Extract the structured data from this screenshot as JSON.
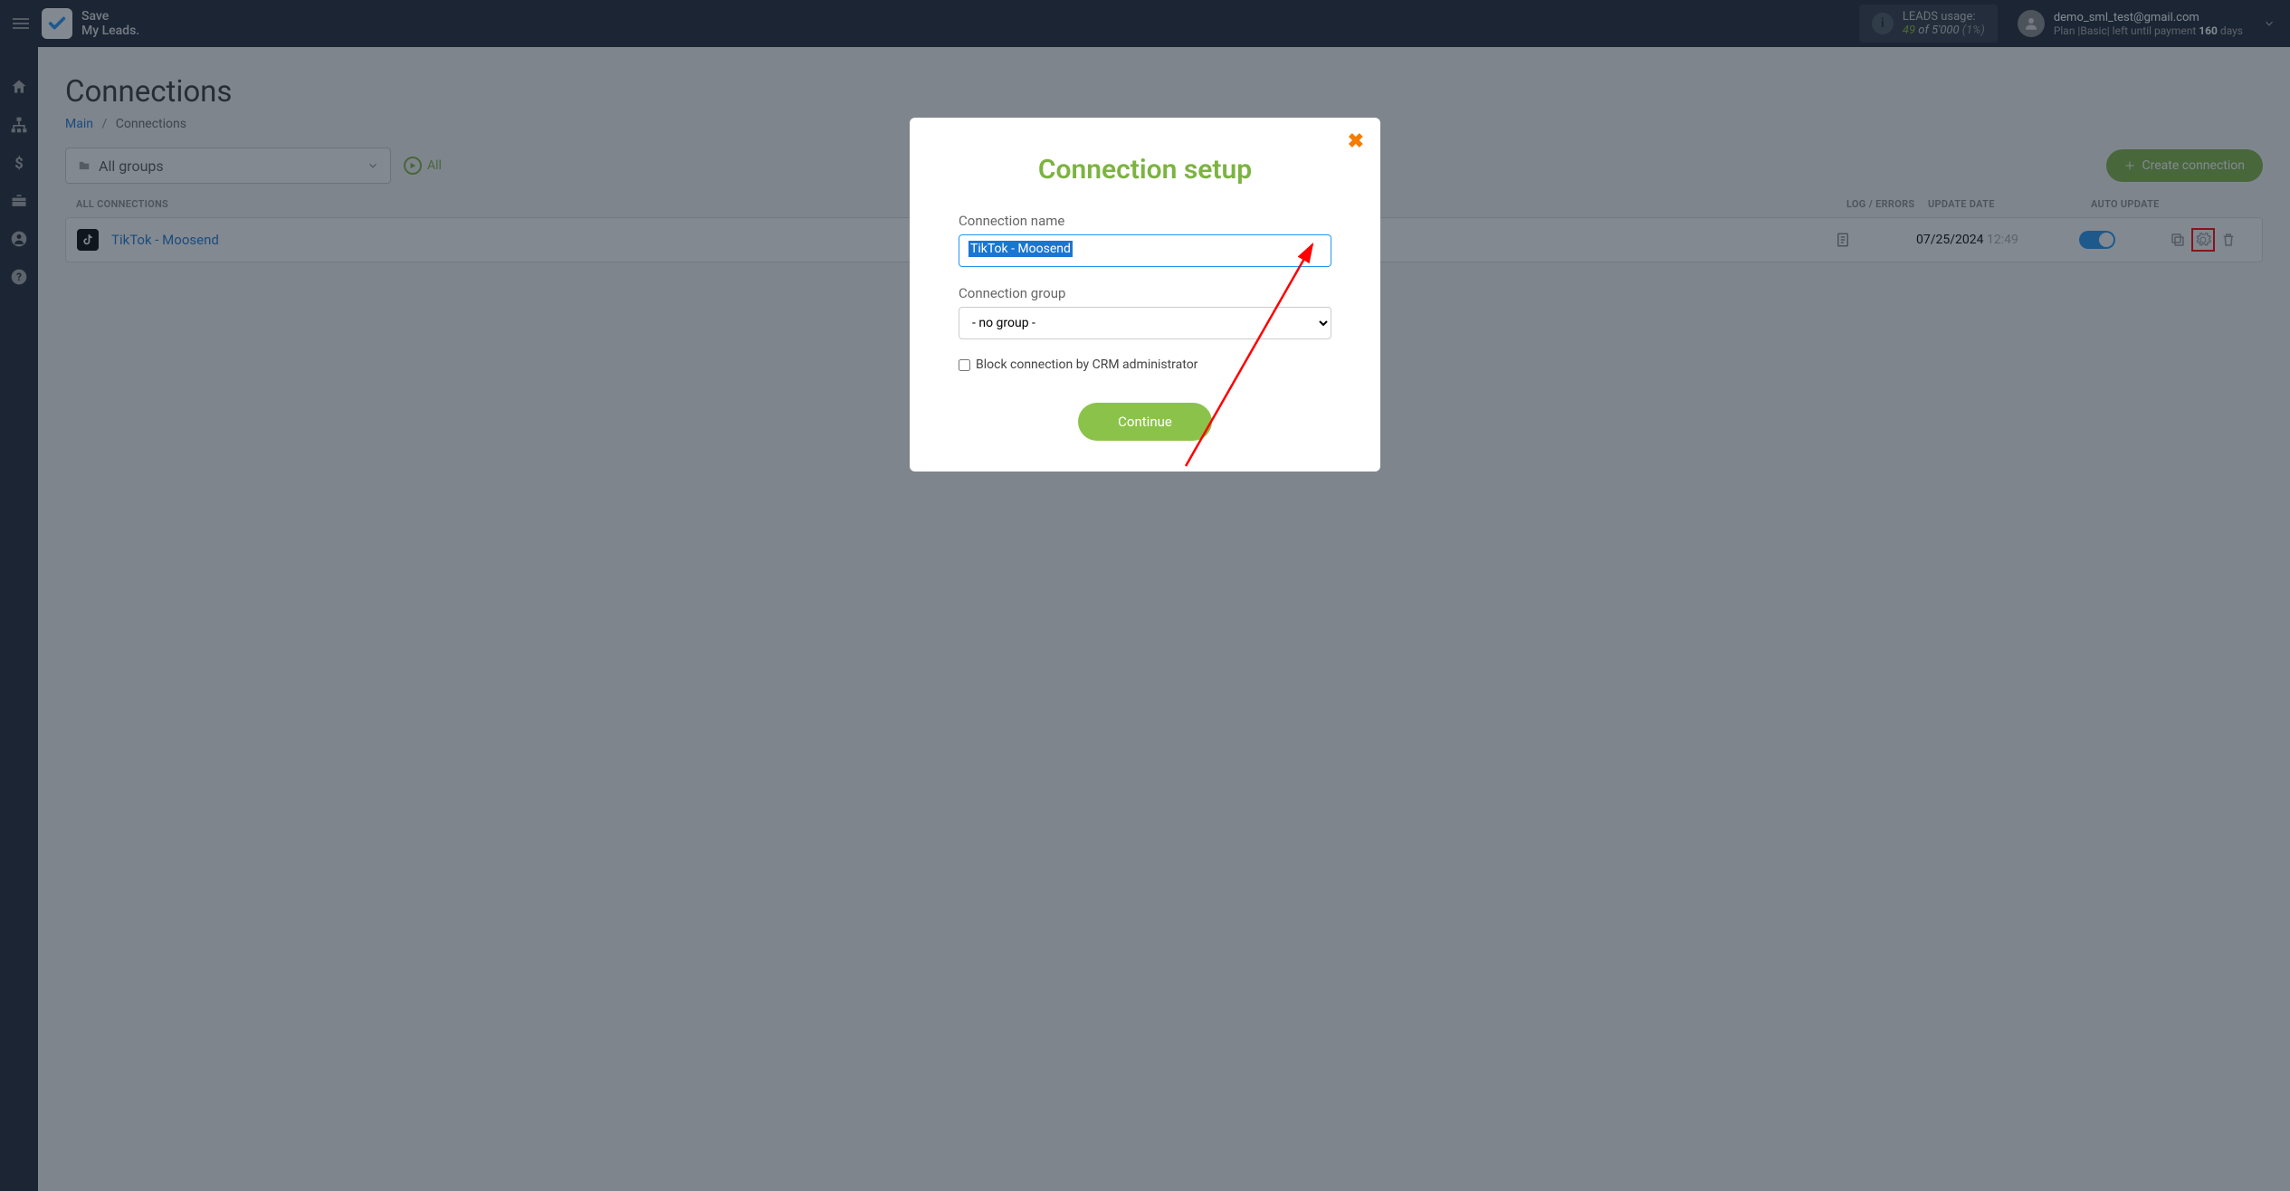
{
  "brand": {
    "line1": "Save",
    "line2": "My Leads."
  },
  "usage": {
    "label": "LEADS usage:",
    "current": "49",
    "of_word": "of",
    "total": "5'000",
    "percent": "(1%)"
  },
  "user": {
    "email": "demo_sml_test@gmail.com",
    "plan_prefix": "Plan |Basic| left until payment",
    "days": "160",
    "days_suffix": "days"
  },
  "page": {
    "title": "Connections"
  },
  "breadcrumb": {
    "main": "Main",
    "sep": "/",
    "current": "Connections"
  },
  "filters": {
    "all_groups": "All groups",
    "all": "All"
  },
  "create_btn": "Create connection",
  "table_headers": {
    "all": "ALL CONNECTIONS",
    "log": "LOG / ERRORS",
    "date": "UPDATE DATE",
    "auto": "AUTO UPDATE"
  },
  "connection": {
    "name": "TikTok - Moosend",
    "date": "07/25/2024",
    "time": "12:49"
  },
  "modal": {
    "title": "Connection setup",
    "name_label": "Connection name",
    "name_value": "TikTok - Moosend",
    "group_label": "Connection group",
    "group_value": "- no group -",
    "block_label": "Block connection by CRM administrator",
    "continue": "Continue"
  }
}
